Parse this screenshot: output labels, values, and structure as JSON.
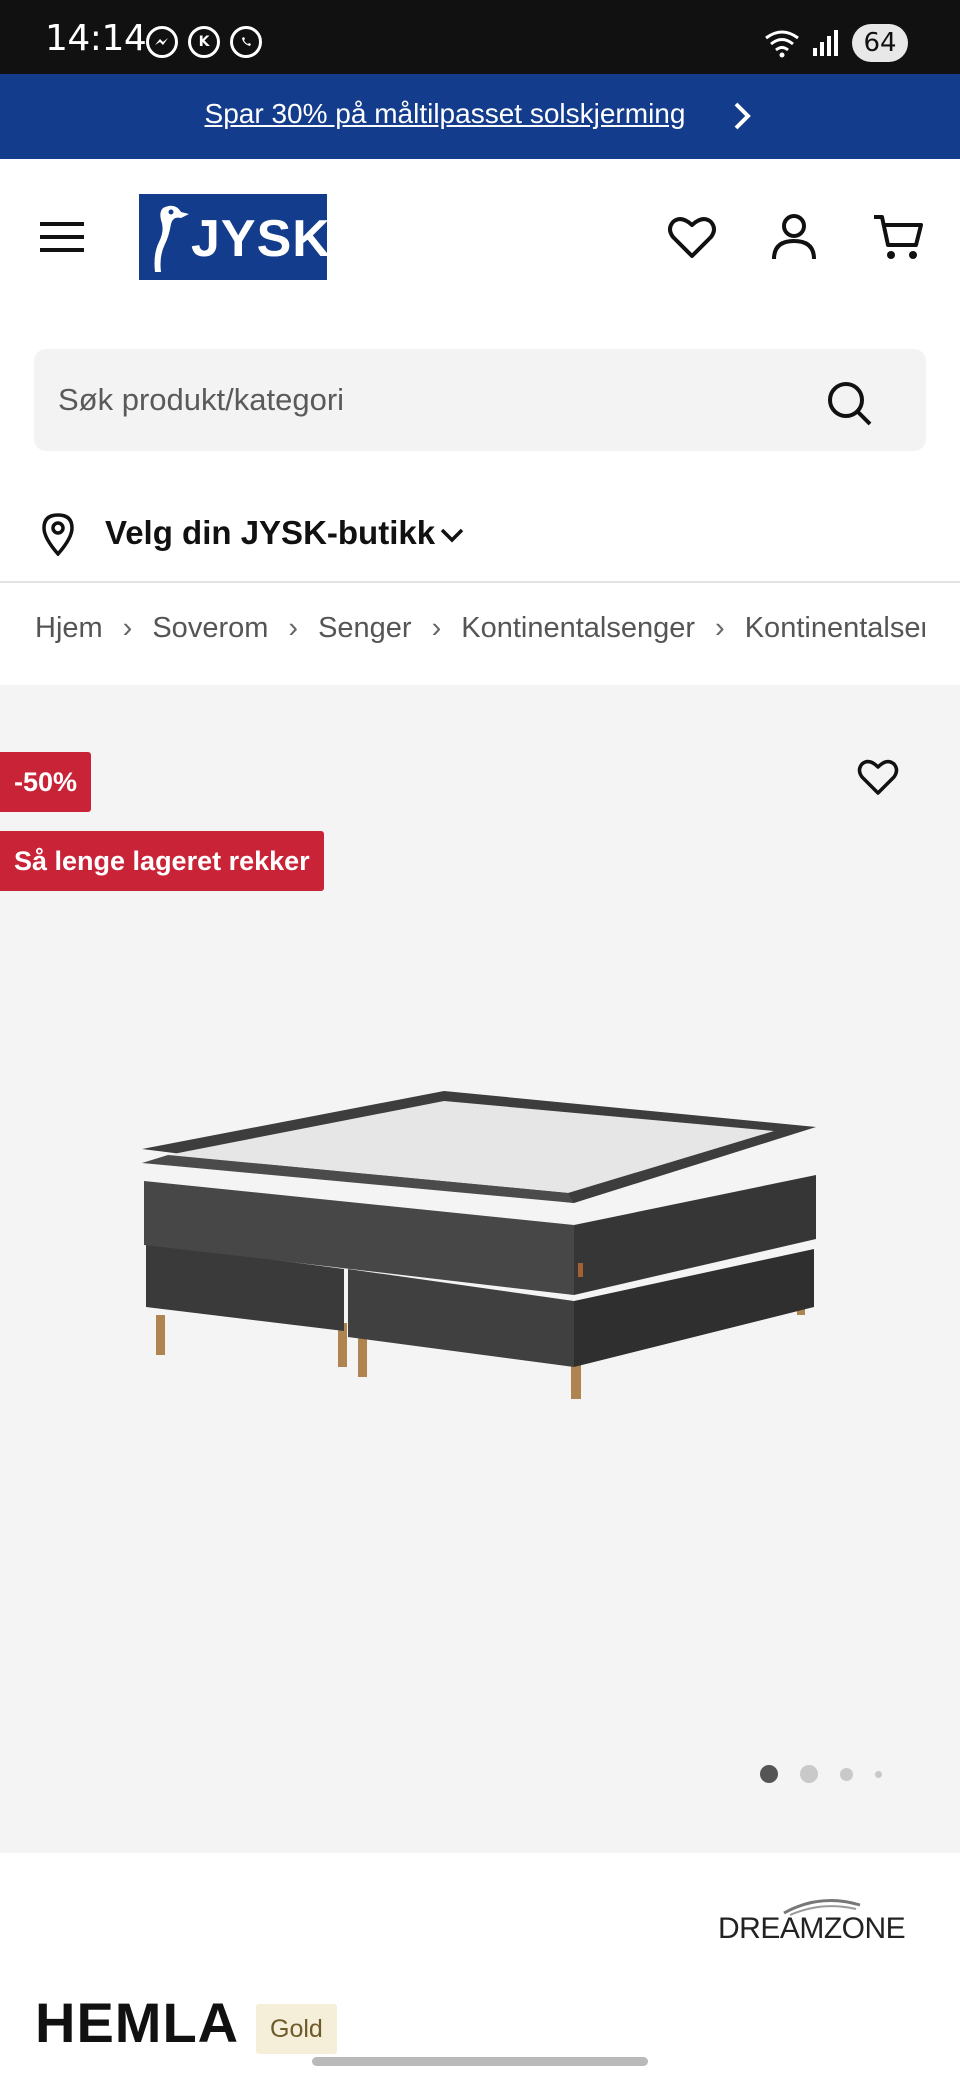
{
  "status_bar": {
    "time": "14:14",
    "battery": "64"
  },
  "promo": {
    "text": "Spar 30% på måltilpasset solskjerming"
  },
  "header": {
    "logo_text": "JYSK"
  },
  "search": {
    "placeholder": "Søk produkt/kategori"
  },
  "store": {
    "label": "Velg din JYSK-butikk"
  },
  "breadcrumb": [
    "Hjem",
    "Soverom",
    "Senger",
    "Kontinentalsenger",
    "Kontinentalsenger"
  ],
  "gallery": {
    "discount_badge": "-50%",
    "stock_badge": "Så lenge lageret rekker",
    "image_count": 4,
    "active_image": 1
  },
  "product": {
    "brand": "DREAMZONE",
    "name": "HEMLA",
    "tier": "Gold"
  },
  "colors": {
    "brand_blue": "#143c8c",
    "sale_red": "#c92337",
    "gold_bg": "#f5eed9"
  }
}
